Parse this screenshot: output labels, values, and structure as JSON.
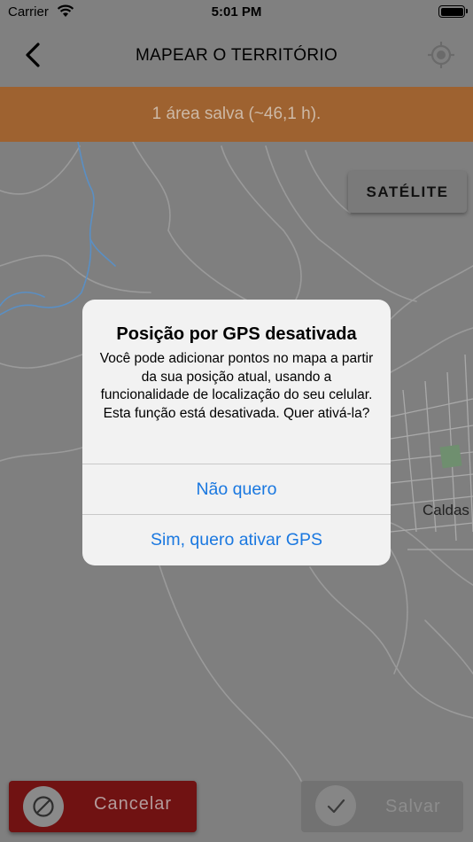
{
  "status_bar": {
    "carrier": "Carrier",
    "time": "5:01 PM"
  },
  "nav": {
    "title": "MAPEAR O TERRITÓRIO",
    "back_icon": "chevron-left-icon",
    "locate_icon": "crosshair-icon"
  },
  "banner": {
    "text": "1 área salva (~46,1 h)."
  },
  "map": {
    "satellite_label": "SATÉLITE",
    "town_label": "Caldas"
  },
  "dialog": {
    "title": "Posição por GPS desativada",
    "message": "Você pode adicionar pontos no mapa a partir da sua posição atual, usando a funcionalidade de localização do seu celular. Esta função está desativada. Quer ativá-la?",
    "actions": [
      {
        "label": "Não quero"
      },
      {
        "label": "Sim, quero ativar GPS"
      }
    ]
  },
  "bottom": {
    "cancel_label": "Cancelar",
    "save_label": "Salvar"
  },
  "colors": {
    "banner": "#9e6230",
    "cancel": "#701212",
    "action_blue": "#1a78e0",
    "water": "#5a8fc4"
  }
}
